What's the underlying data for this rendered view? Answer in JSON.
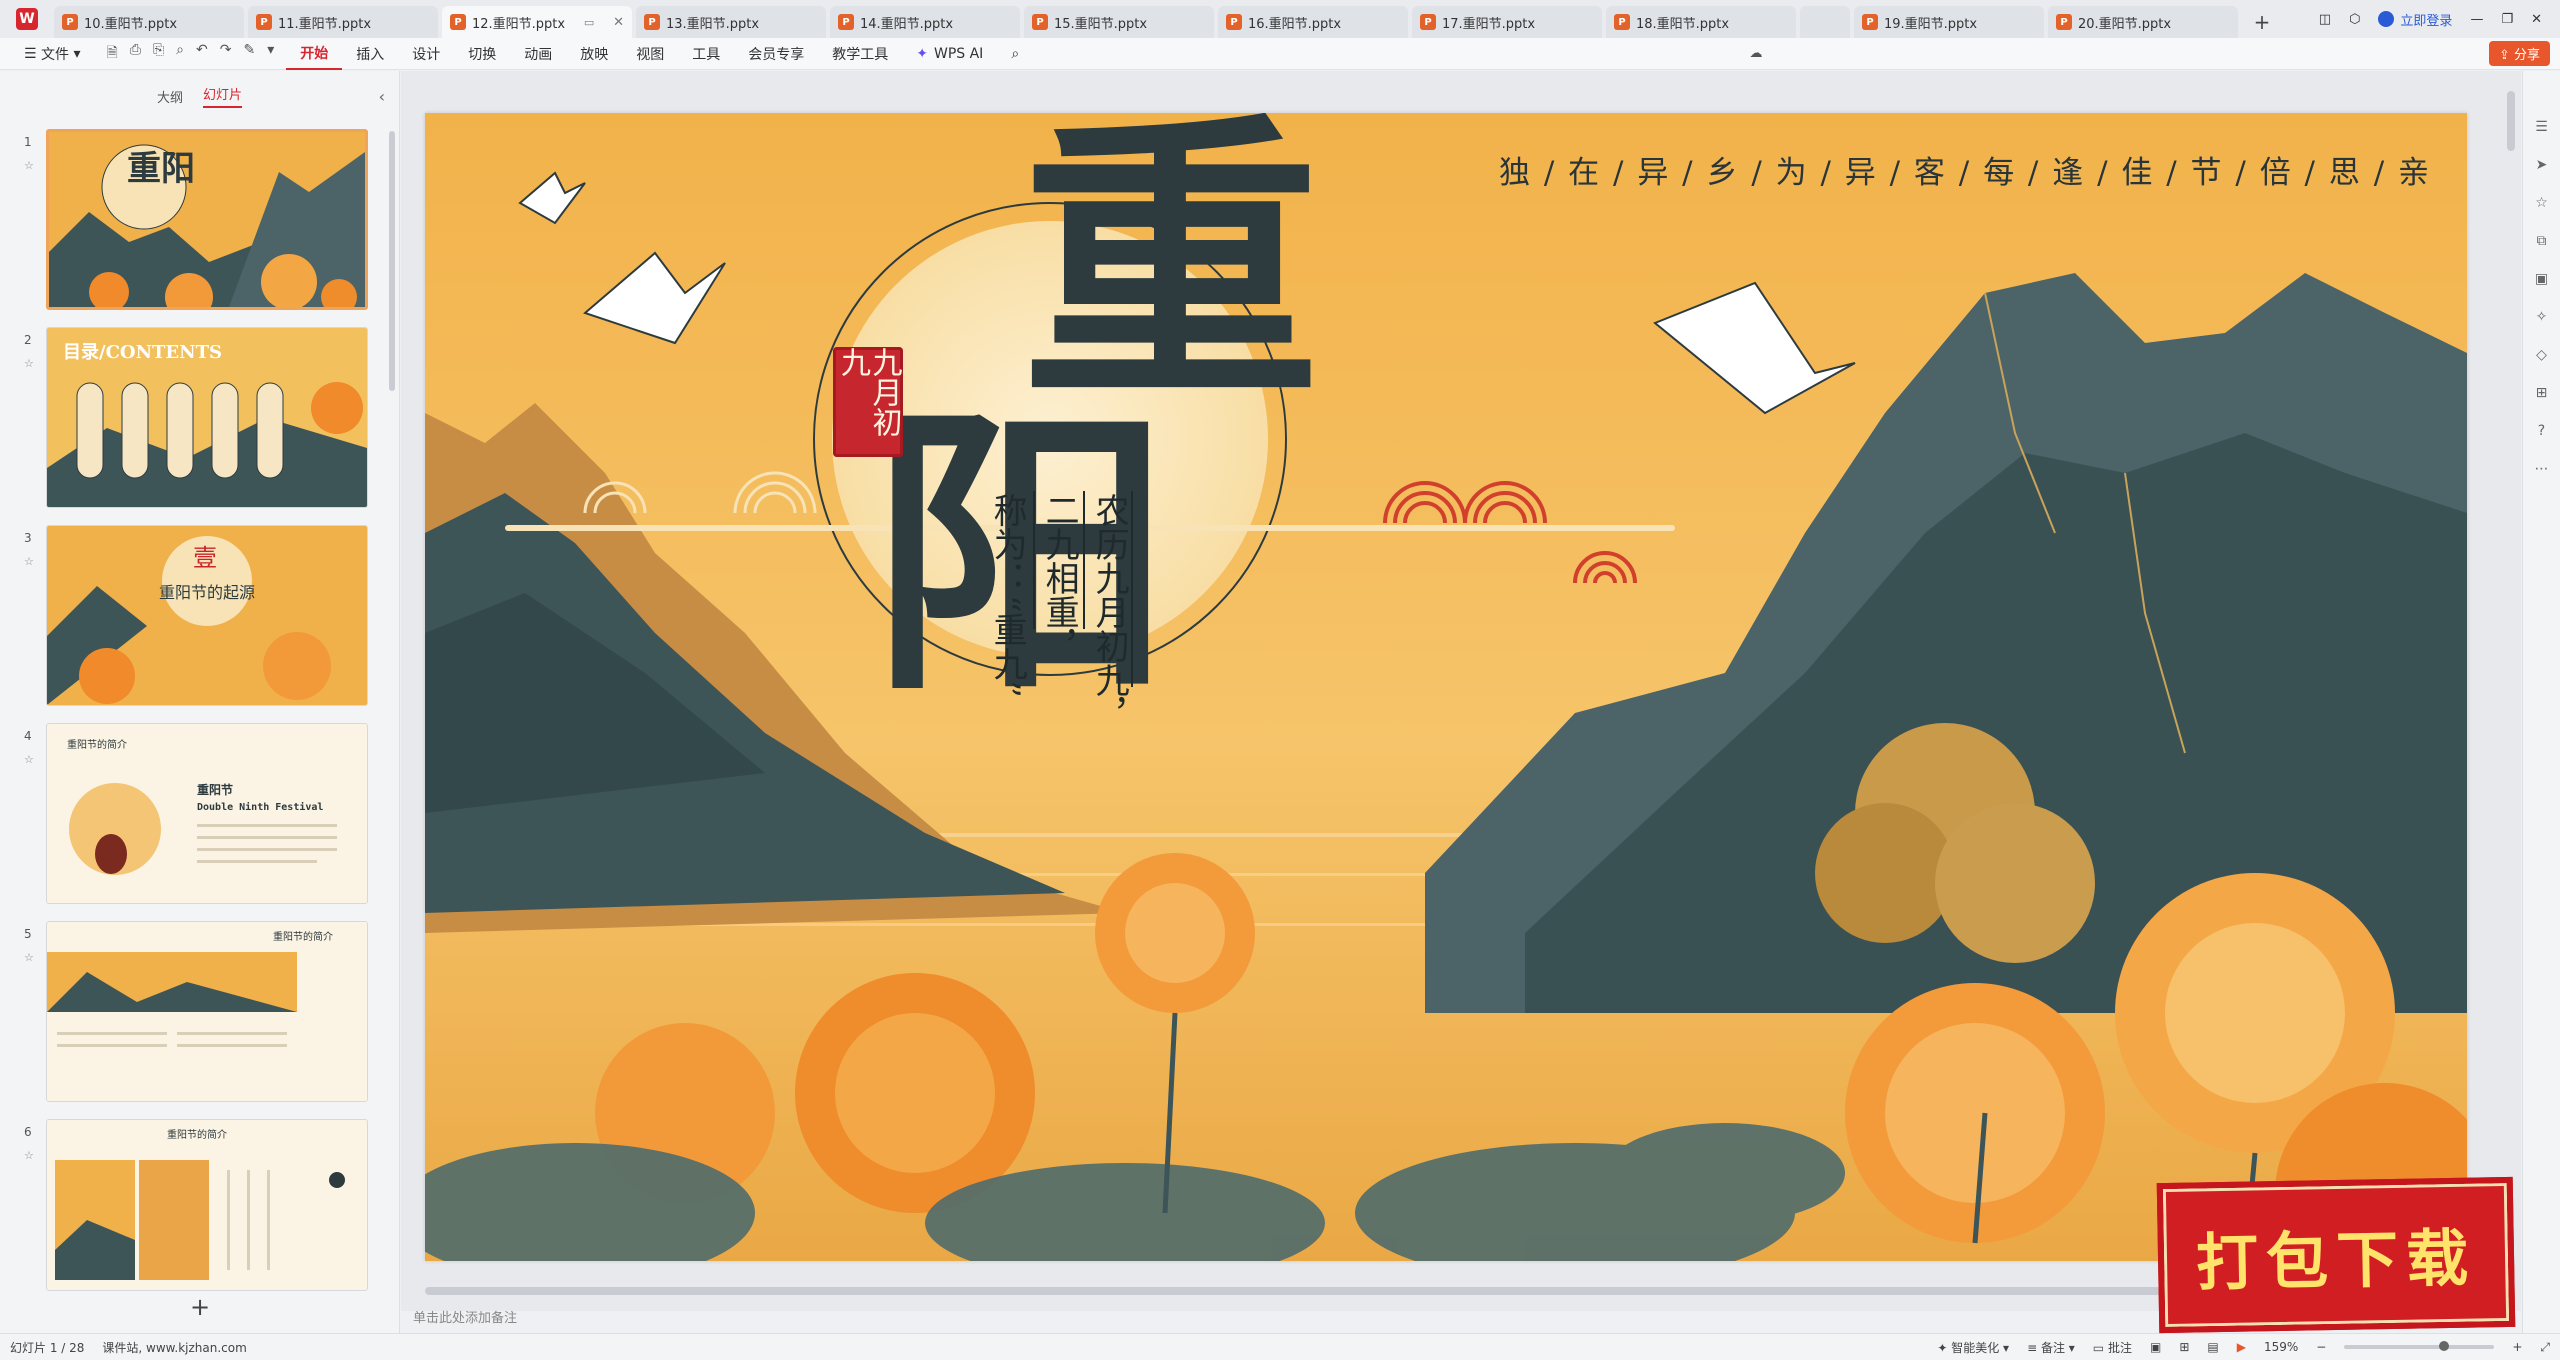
{
  "tabs": [
    {
      "label": "10.重阳节.pptx"
    },
    {
      "label": "11.重阳节.pptx"
    },
    {
      "label": "12.重阳节.pptx"
    },
    {
      "label": "13.重阳节.pptx"
    },
    {
      "label": "14.重阳节.pptx"
    },
    {
      "label": "15.重阳节.pptx"
    },
    {
      "label": "16.重阳节.pptx"
    },
    {
      "label": "17.重阳节.pptx"
    },
    {
      "label": "18.重阳节.pptx"
    },
    {
      "label": "19.重阳节.pptx"
    },
    {
      "label": "20.重阳节.pptx"
    }
  ],
  "titlebar": {
    "login": "立即登录"
  },
  "menu": {
    "file": "文件",
    "items": [
      "开始",
      "插入",
      "设计",
      "切换",
      "动画",
      "放映",
      "视图",
      "工具",
      "会员专享",
      "教学工具"
    ],
    "wps_ai": "WPS AI",
    "share": "分享"
  },
  "leftpanel": {
    "outline_tab": "大纲",
    "slides_tab": "幻灯片",
    "thumbs": [
      {
        "num": "1",
        "title": "重阳"
      },
      {
        "num": "2",
        "title": "目录/CONTENTS"
      },
      {
        "num": "3",
        "title": "重阳节的起源",
        "mark": "壹"
      },
      {
        "num": "4",
        "title": "重阳节",
        "subtitle": "Double Ninth Festival",
        "header": "重阳节的简介"
      },
      {
        "num": "5",
        "header": "重阳节的简介"
      },
      {
        "num": "6",
        "header": "重阳节的简介"
      }
    ]
  },
  "slide": {
    "poem": "独 / 在 / 异 / 乡 / 为 / 异 / 客 / 每 / 逢 / 佳 / 节 / 倍 / 思 / 亲",
    "title_char1": "重",
    "title_char2": "阳",
    "seal": "九月初九",
    "line1": "农历九月初九，",
    "line2": "二九相重，",
    "line3": "称为：“重九”"
  },
  "notes_placeholder": "单击此处添加备注",
  "statusbar": {
    "slide_count": "幻灯片 1 / 28",
    "site": "课件站, www.kjzhan.com",
    "smart": "智能美化",
    "notes": "备注",
    "comment": "批注",
    "zoom": "159%"
  },
  "banner": {
    "text": "打包下载"
  },
  "colors": {
    "accent": "#d8262f",
    "slide_bg": "#f2b24a",
    "mountain": "#3d5458"
  }
}
